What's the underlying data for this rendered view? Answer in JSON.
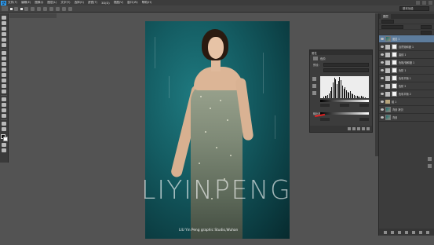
{
  "app": {
    "logo": "Ps"
  },
  "menu": [
    "文件(F)",
    "编辑(E)",
    "图像(I)",
    "图层(L)",
    "文字(Y)",
    "选择(S)",
    "滤镜(T)",
    "3D(D)",
    "视图(V)",
    "窗口(W)",
    "帮助(H)"
  ],
  "options": {
    "workspace": "基本功能"
  },
  "adjustments": {
    "panel_title": "属性",
    "type_label": "色阶",
    "preset_label": "预设:",
    "output_label": "输出色阶:"
  },
  "layers": {
    "tab": "图层",
    "items": [
      {
        "name": "图层 1",
        "kind": "photo"
      },
      {
        "name": "自然饱和度 1",
        "kind": "adj"
      },
      {
        "name": "曲线 1",
        "kind": "adj"
      },
      {
        "name": "色相/饱和度 1",
        "kind": "adj"
      },
      {
        "name": "色阶 1",
        "kind": "adj"
      },
      {
        "name": "色彩平衡 1",
        "kind": "adj"
      },
      {
        "name": "色阶 2",
        "kind": "adj"
      },
      {
        "name": "色彩平衡 2",
        "kind": "adj"
      },
      {
        "name": "组 1",
        "kind": "folder"
      },
      {
        "name": "背景 拷贝",
        "kind": "photo"
      },
      {
        "name": "背景",
        "kind": "photo"
      }
    ]
  },
  "canvas": {
    "watermark": "LIYINPENG",
    "credit": "LIU Yin Peng  graphic Studio,Wuhan"
  },
  "colors": {
    "backdrop": "#145c62",
    "selection": "#5d7c9c",
    "annotation_arrow": "#e02020"
  }
}
